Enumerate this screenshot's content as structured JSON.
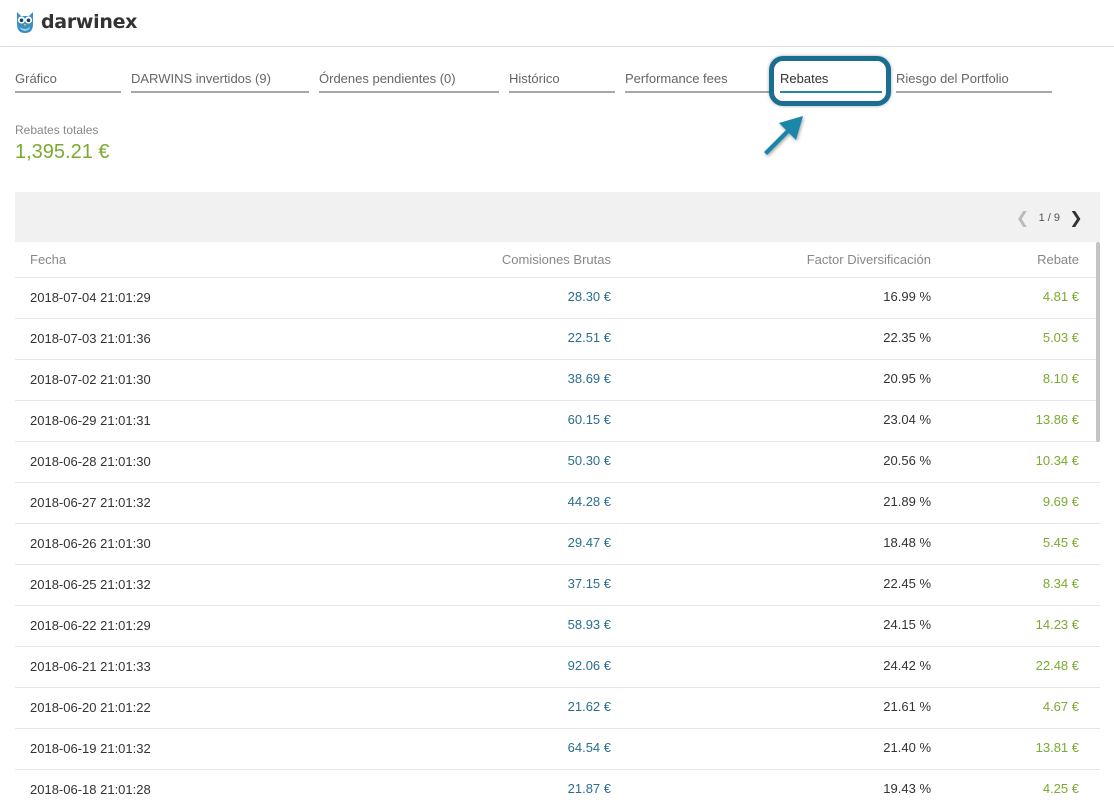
{
  "brand": {
    "name": "darwinex"
  },
  "tabs": [
    {
      "label": "Gráfico"
    },
    {
      "label": "DARWINS invertidos (9)"
    },
    {
      "label": "Órdenes pendientes (0)"
    },
    {
      "label": "Histórico"
    },
    {
      "label": "Performance fees"
    },
    {
      "label": "Rebates"
    },
    {
      "label": "Riesgo del Portfolio"
    }
  ],
  "active_tab": "Rebates",
  "totals": {
    "label": "Rebates totales",
    "value": "1,395.21 €"
  },
  "pager": {
    "text": "1 / 9"
  },
  "table": {
    "headers": [
      "Fecha",
      "Comisiones Brutas",
      "Factor Diversificación",
      "Rebate"
    ],
    "rows": [
      [
        "2018-07-04 21:01:29",
        "28.30 €",
        "16.99 %",
        "4.81 €"
      ],
      [
        "2018-07-03 21:01:36",
        "22.51 €",
        "22.35 %",
        "5.03 €"
      ],
      [
        "2018-07-02 21:01:30",
        "38.69 €",
        "20.95 %",
        "8.10 €"
      ],
      [
        "2018-06-29 21:01:31",
        "60.15 €",
        "23.04 %",
        "13.86 €"
      ],
      [
        "2018-06-28 21:01:30",
        "50.30 €",
        "20.56 %",
        "10.34 €"
      ],
      [
        "2018-06-27 21:01:32",
        "44.28 €",
        "21.89 %",
        "9.69 €"
      ],
      [
        "2018-06-26 21:01:30",
        "29.47 €",
        "18.48 %",
        "5.45 €"
      ],
      [
        "2018-06-25 21:01:32",
        "37.15 €",
        "22.45 %",
        "8.34 €"
      ],
      [
        "2018-06-22 21:01:29",
        "58.93 €",
        "24.15 %",
        "14.23 €"
      ],
      [
        "2018-06-21 21:01:33",
        "92.06 €",
        "24.42 %",
        "22.48 €"
      ],
      [
        "2018-06-20 21:01:22",
        "21.62 €",
        "21.61 %",
        "4.67 €"
      ],
      [
        "2018-06-19 21:01:32",
        "64.54 €",
        "21.40 %",
        "13.81 €"
      ],
      [
        "2018-06-18 21:01:28",
        "21.87 €",
        "19.43 %",
        "4.25 €"
      ]
    ]
  },
  "colors": {
    "accent": "#1c8aa8",
    "highlight": "#1a6e8f",
    "positive": "#7aab30",
    "link": "#2a6f8e"
  },
  "icons": {
    "logo": "owl-icon",
    "prev": "chevron-left-icon",
    "next": "chevron-right-icon",
    "pointer": "arrow-pointer-icon"
  }
}
